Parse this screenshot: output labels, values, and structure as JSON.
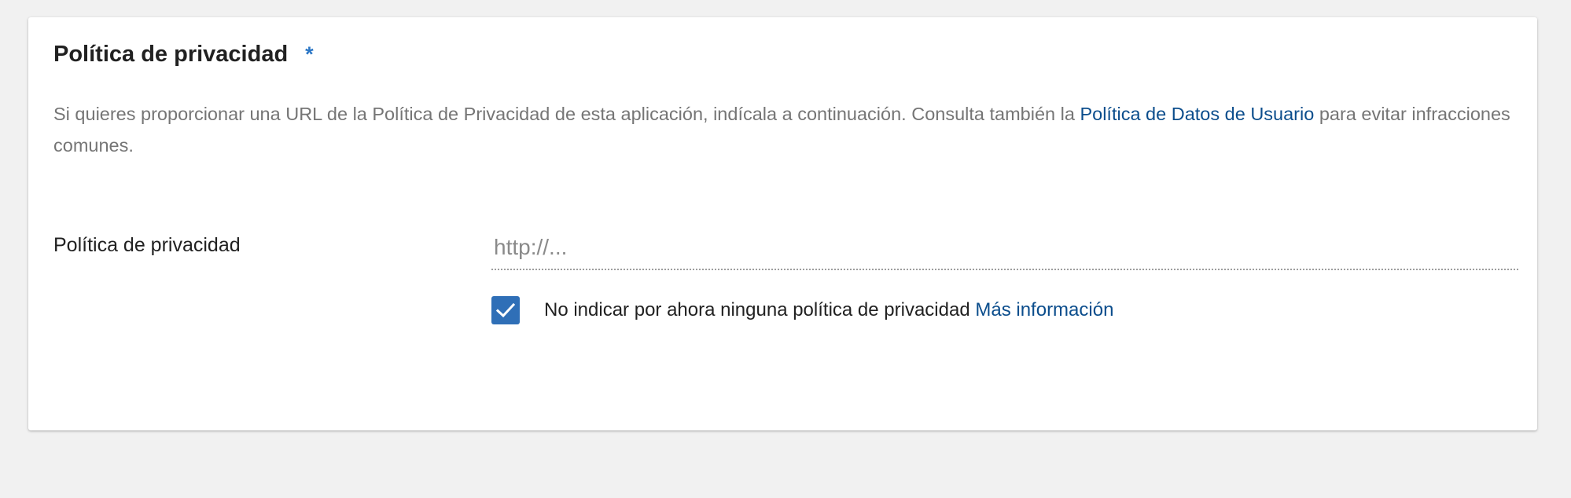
{
  "section": {
    "title": "Política de privacidad",
    "required_marker": "*",
    "description_text": "Si quieres proporcionar una URL de la Política de Privacidad de esta aplicación, indícala a continuación. Consulta también la ",
    "description_link": "Política de Datos de Usuario",
    "description_after": " para evitar infracciones comunes."
  },
  "field": {
    "label": "Política de privacidad",
    "placeholder": "http://...",
    "value": ""
  },
  "checkbox": {
    "checked": true,
    "label": "No indicar por ahora ninguna política de privacidad",
    "link": "Más información",
    "icon": "checkmark-icon"
  },
  "colors": {
    "accent": "#2f6fb7",
    "link": "#0b4d8c",
    "required": "#2b76c5",
    "background": "#f1f1f1"
  }
}
